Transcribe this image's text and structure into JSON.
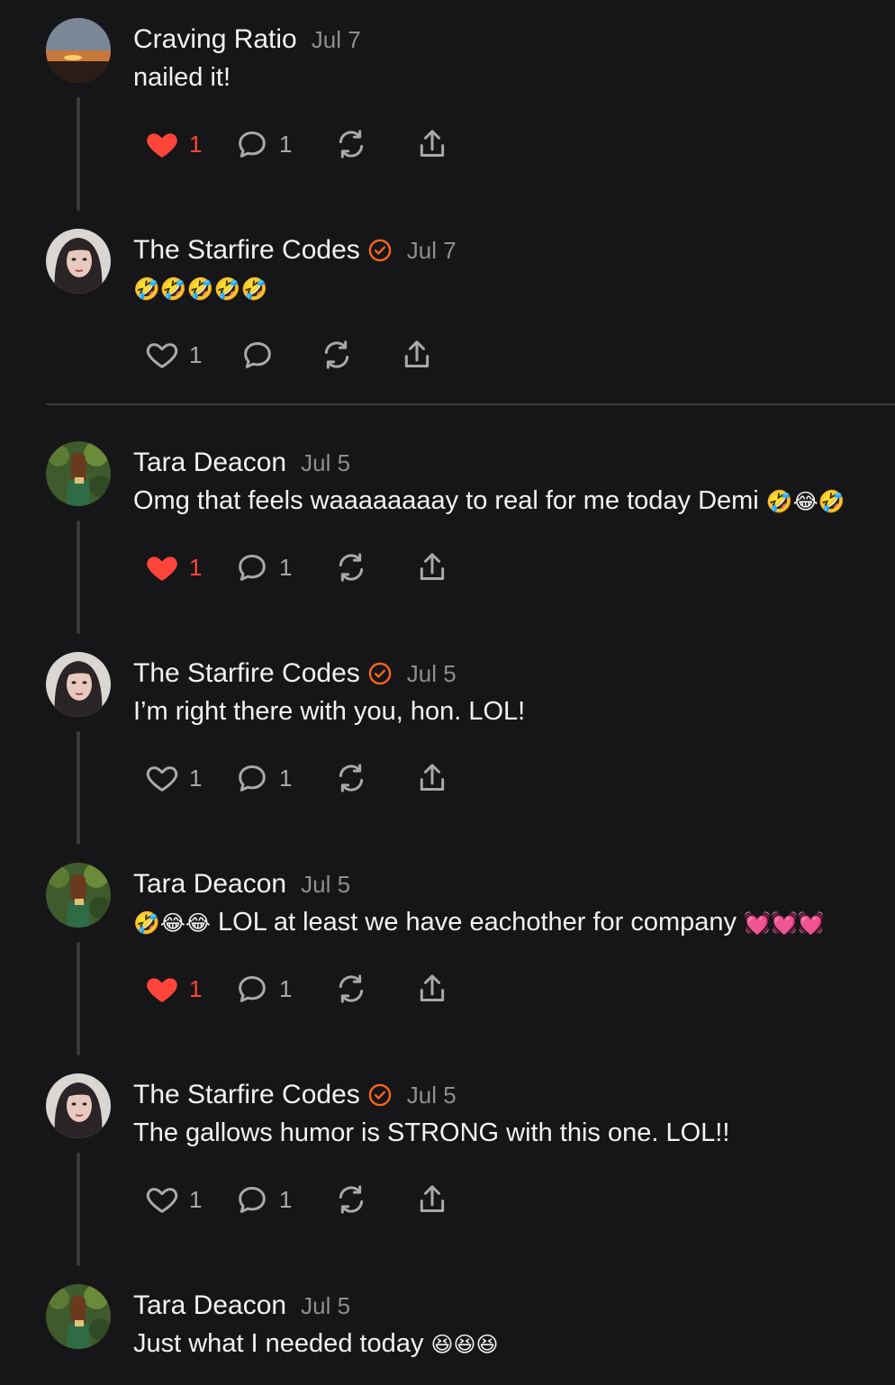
{
  "colors": {
    "background": "#161618",
    "accent_like": "#ff453a",
    "verified": "#ff6719",
    "muted": "#8e8e93"
  },
  "comments": [
    {
      "author": "Craving Ratio",
      "verified": false,
      "date": "Jul 7",
      "text": "nailed it!",
      "emoji": "",
      "likes": "1",
      "liked": true,
      "replies": "1",
      "avatar": "sunset-avatar"
    },
    {
      "author": "The Starfire Codes",
      "verified": true,
      "date": "Jul 7",
      "text": "",
      "emoji": "🤣🤣🤣🤣🤣",
      "likes": "1",
      "liked": false,
      "replies": "",
      "avatar": "woman-avatar"
    },
    {
      "author": "Tara Deacon",
      "verified": false,
      "date": "Jul 5",
      "text": "Omg that feels waaaaaaaay to real for me today Demi ",
      "emoji": "🤣😂🤣",
      "likes": "1",
      "liked": true,
      "replies": "1",
      "avatar": "forest-avatar"
    },
    {
      "author": "The Starfire Codes",
      "verified": true,
      "date": "Jul 5",
      "text": "I’m right there with you, hon. LOL!",
      "emoji": "",
      "likes": "1",
      "liked": false,
      "replies": "1",
      "avatar": "woman-avatar"
    },
    {
      "author": "Tara Deacon",
      "verified": false,
      "date": "Jul 5",
      "text_prefix_emoji": "🤣😂😂",
      "text": " LOL at least we have eachother for company ",
      "emoji": "💓💓💓",
      "likes": "1",
      "liked": true,
      "replies": "1",
      "avatar": "forest-avatar"
    },
    {
      "author": "The Starfire Codes",
      "verified": true,
      "date": "Jul 5",
      "text": "The gallows humor is STRONG with this one. LOL!!",
      "emoji": "",
      "likes": "1",
      "liked": false,
      "replies": "1",
      "avatar": "woman-avatar"
    },
    {
      "author": "Tara Deacon",
      "verified": false,
      "date": "Jul 5",
      "text": "Just what I needed today ",
      "emoji": "😆😆😆",
      "likes": "",
      "liked": false,
      "replies": "",
      "avatar": "forest-avatar"
    }
  ]
}
